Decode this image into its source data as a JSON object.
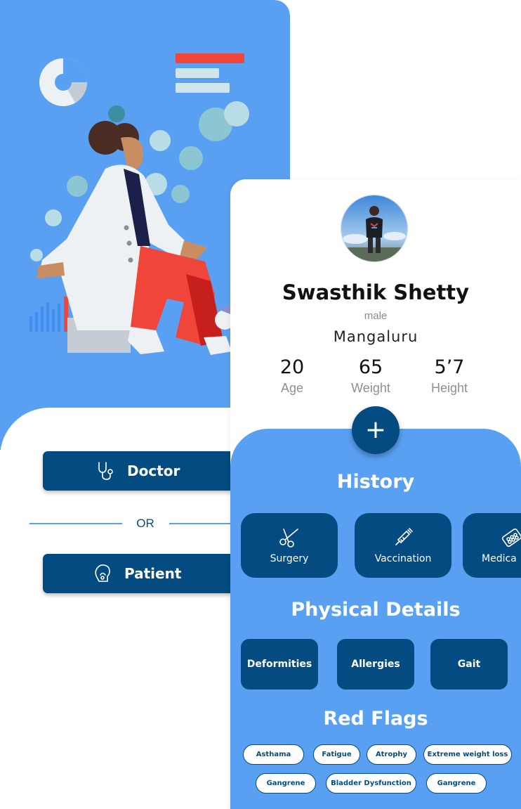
{
  "role_select": {
    "doctor_label": "Doctor",
    "or_label": "OR",
    "patient_label": "Patient"
  },
  "profile": {
    "name": "Swasthik Shetty",
    "gender": "male",
    "city": "Mangaluru",
    "stats": [
      {
        "value": "20",
        "label": "Age"
      },
      {
        "value": "65",
        "label": "Weight"
      },
      {
        "value": "5’7",
        "label": "Height"
      }
    ],
    "add_symbol": "+"
  },
  "history": {
    "title": "History",
    "items": [
      {
        "label": "Surgery",
        "icon": "scissors-icon"
      },
      {
        "label": "Vaccination",
        "icon": "syringe-icon"
      },
      {
        "label": "Medica",
        "icon": "pills-icon"
      }
    ]
  },
  "physical": {
    "title": "Physical Details",
    "items": [
      "Deformities",
      "Allergies",
      "Gait"
    ]
  },
  "red_flags": {
    "title": "Red Flags",
    "chips": [
      "Asthama",
      "Fatigue",
      "Atrophy",
      "Extreme weight loss",
      "Gangrene",
      "Bladder Dysfunction",
      "Gangrene"
    ]
  },
  "colors": {
    "brand_blue": "#5aa0f2",
    "dark_blue": "#044b81",
    "accent_red": "#f0453a"
  }
}
